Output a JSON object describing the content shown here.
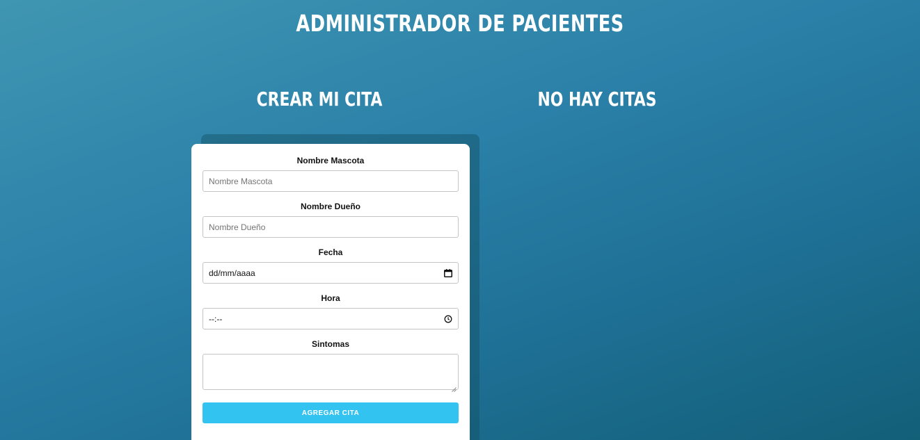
{
  "header": {
    "title": "ADMINISTRADOR DE PACIENTES"
  },
  "form_section": {
    "heading": "CREAR MI CITA",
    "fields": {
      "pet_name": {
        "label": "Nombre Mascota",
        "placeholder": "Nombre Mascota"
      },
      "owner_name": {
        "label": "Nombre Dueño",
        "placeholder": "Nombre Dueño"
      },
      "date": {
        "label": "Fecha",
        "value": "dd/mm/aaaa",
        "icon": "calendar-icon"
      },
      "time": {
        "label": "Hora",
        "value": "--:--",
        "icon": "clock-icon"
      },
      "symptoms": {
        "label": "Sintomas",
        "value": ""
      }
    },
    "submit_label": "AGREGAR CITA"
  },
  "appointments_section": {
    "heading": "NO HAY CITAS"
  },
  "colors": {
    "accent": "#33c3f0",
    "background_start": "#3f96b2",
    "background_end": "#125f78",
    "card": "#ffffff"
  }
}
